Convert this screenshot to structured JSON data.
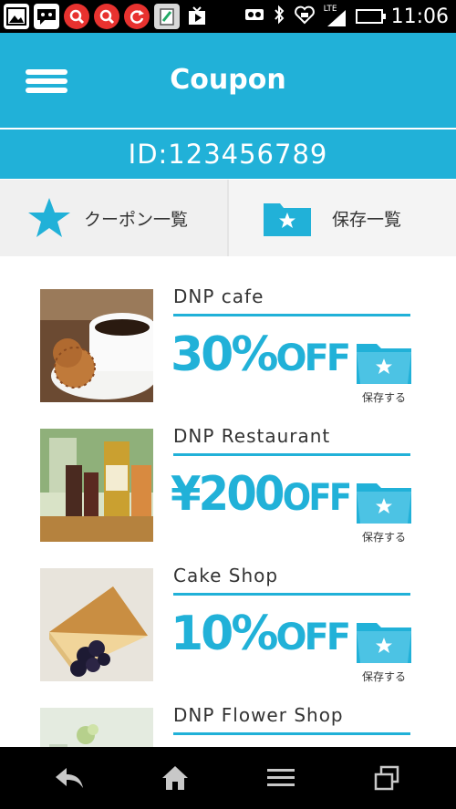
{
  "status_bar": {
    "time": "11:06",
    "signal_label": "LTE",
    "icons": [
      "gallery-icon",
      "message-icon",
      "search-app-icon",
      "search-app-icon",
      "sync-icon",
      "clipboard-icon",
      "media-play-icon",
      "voicemail-icon",
      "bluetooth-icon",
      "heart-shield-icon",
      "signal-icon",
      "battery-icon"
    ]
  },
  "header": {
    "title": "Coupon",
    "menu_icon": "hamburger-menu-icon",
    "user_id": "ID:123456789"
  },
  "tabs": [
    {
      "label": "クーポン一覧",
      "icon": "star-icon"
    },
    {
      "label": "保存一覧",
      "icon": "folder-star-icon"
    }
  ],
  "coupons": [
    {
      "shop": "DNP cafe",
      "deal_big": "30%",
      "deal_small": "OFF",
      "save_label": "保存する",
      "image": "coffee-cookies"
    },
    {
      "shop": "DNP Restaurant",
      "deal_big": "¥200",
      "deal_small": "OFF",
      "save_label": "保存する",
      "image": "olive-oil-bottles"
    },
    {
      "shop": "Cake Shop",
      "deal_big": "10%",
      "deal_small": "OFF",
      "save_label": "保存する",
      "image": "cheesecake-blueberries"
    },
    {
      "shop": "DNP Flower Shop",
      "deal_big": "",
      "deal_small": "",
      "save_label": "",
      "image": "flower-shop"
    }
  ],
  "colors": {
    "accent": "#21b1d8",
    "header_bg": "#21b1d8",
    "tabs_bg": "#f0f0f0",
    "nav_bg": "#000000"
  },
  "nav_bar": {
    "buttons": [
      "back-icon",
      "home-icon",
      "menu-icon",
      "recent-apps-icon"
    ]
  }
}
